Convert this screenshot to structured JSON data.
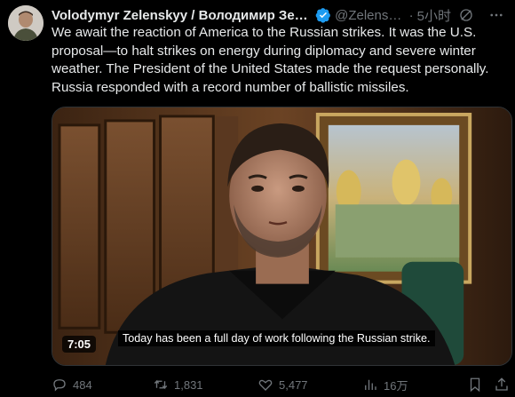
{
  "author": {
    "name": "Volodymyr Zelenskyy / Володимир Зел...",
    "handle": "@Zelensk...",
    "separator": "·",
    "time": "5小时"
  },
  "tweet": {
    "text": "We await the reaction of America to the Russian strikes. It was the U.S. proposal—to halt strikes on energy during diplomacy and severe winter weather. The President of the United States made the request personally. Russia responded with a record number of ballistic missiles."
  },
  "video": {
    "caption": "Today has been a full day of work following the Russian strike.",
    "duration": "7:05"
  },
  "actions": {
    "replies": "484",
    "reposts": "1,831",
    "likes": "5,477",
    "views": "16万"
  },
  "colors": {
    "background": "#000000",
    "text_primary": "#e7e9ea",
    "text_secondary": "#71767b",
    "verified": "#1d9bf0"
  },
  "icons": [
    "verified-icon",
    "grok-icon",
    "more-icon",
    "reply-icon",
    "repost-icon",
    "like-icon",
    "views-icon",
    "bookmark-icon",
    "share-icon"
  ]
}
